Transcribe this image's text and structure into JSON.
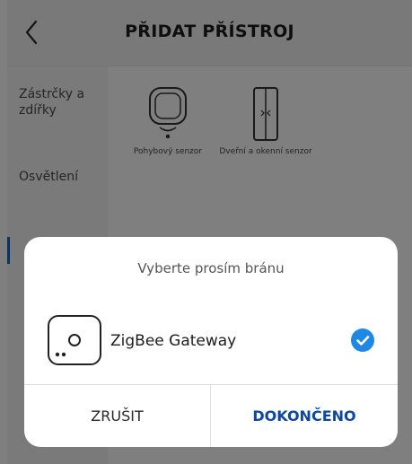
{
  "header": {
    "title": "PŘIDAT PŘÍSTROJ",
    "back_icon": "chevron-left-icon"
  },
  "sidebar": {
    "items": [
      {
        "label": "Zástrčky a zdířky"
      },
      {
        "label": "Osvětlení"
      }
    ],
    "accent_color": "#1565c0"
  },
  "devices": [
    {
      "label": "Pohybový senzor",
      "icon": "motion-sensor-icon"
    },
    {
      "label": "Dveřní a okenní senzor",
      "icon": "door-window-sensor-icon"
    }
  ],
  "dialog": {
    "title": "Vyberte prosím bránu",
    "gateway": {
      "label": "ZigBee Gateway",
      "icon": "gateway-icon",
      "selected": true
    },
    "cancel_label": "ZRUŠIT",
    "done_label": "DOKONČENO"
  },
  "colors": {
    "accent": "#1e88e5",
    "primary_text": "#0d47a1",
    "overlay": "rgba(0,0,0,0.5)"
  }
}
